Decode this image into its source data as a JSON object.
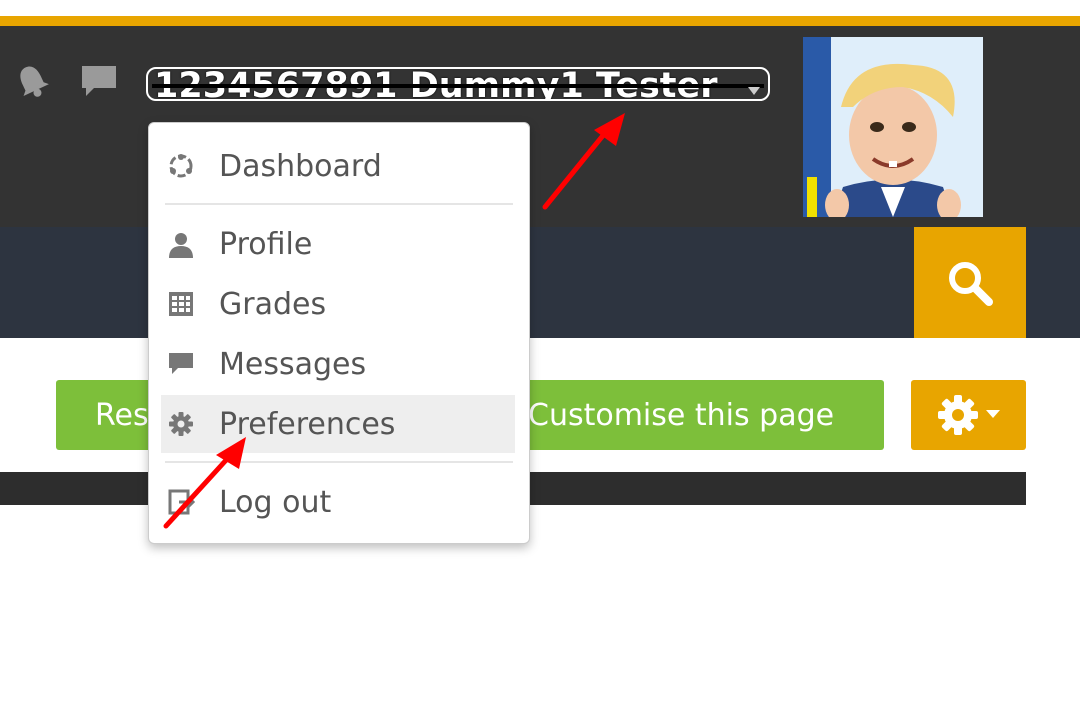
{
  "header": {
    "username": "1234567891 Dummy1 Tester",
    "bell_icon": "bell-icon",
    "messages_icon": "chat-bubble-icon"
  },
  "user_menu": {
    "items": [
      {
        "label": "Dashboard",
        "icon": "dashboard-icon"
      },
      {
        "label": "Profile",
        "icon": "user-icon"
      },
      {
        "label": "Grades",
        "icon": "grades-table-icon"
      },
      {
        "label": "Messages",
        "icon": "chat-bubble-icon"
      },
      {
        "label": "Preferences",
        "icon": "gear-icon"
      },
      {
        "label": "Log out",
        "icon": "logout-icon"
      }
    ]
  },
  "page_actions": {
    "reset_label": "Res",
    "customise_label": "Customise this page"
  },
  "colors": {
    "accent": "#e8a500",
    "header_bg": "#333333",
    "nav_bg": "#2d3440",
    "button_green": "#7dbf3a",
    "annotation_red": "#ff0000"
  }
}
